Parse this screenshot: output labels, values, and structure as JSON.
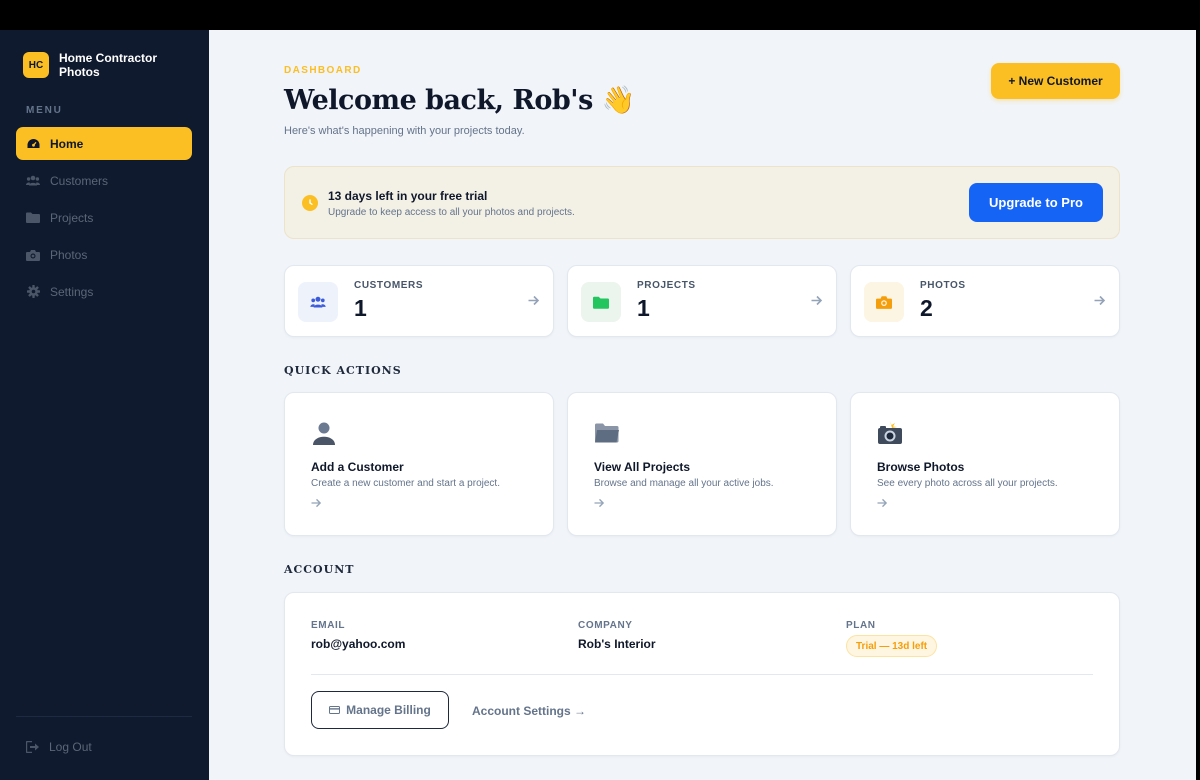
{
  "brand": {
    "initials": "HC",
    "name": "Home Contractor Photos"
  },
  "sidebar": {
    "menu_label": "MENU",
    "items": [
      {
        "label": "Home",
        "icon": "dashboard-icon",
        "active": true
      },
      {
        "label": "Customers",
        "icon": "users-icon",
        "active": false
      },
      {
        "label": "Projects",
        "icon": "folder-icon",
        "active": false
      },
      {
        "label": "Photos",
        "icon": "camera-icon",
        "active": false
      },
      {
        "label": "Settings",
        "icon": "gear-icon",
        "active": false
      }
    ],
    "logout_label": "Log Out"
  },
  "header": {
    "eyebrow": "DASHBOARD",
    "title": "Welcome back, Rob's 👋",
    "subtitle": "Here's what's happening with your projects today.",
    "new_customer_label": "+ New Customer"
  },
  "trial": {
    "title": "13 days left in your free trial",
    "subtitle": "Upgrade to keep access to all your photos and projects.",
    "upgrade_label": "Upgrade to Pro"
  },
  "stats": [
    {
      "label": "CUSTOMERS",
      "value": "1",
      "icon": "users-icon",
      "color": "#3b5bdb"
    },
    {
      "label": "PROJECTS",
      "value": "1",
      "icon": "folder-icon",
      "color": "#22c55e"
    },
    {
      "label": "PHOTOS",
      "value": "2",
      "icon": "camera-icon",
      "color": "#f59e0b"
    }
  ],
  "quick_actions": {
    "title": "QUICK ACTIONS",
    "items": [
      {
        "title": "Add a Customer",
        "desc": "Create a new customer and start a project.",
        "icon": "person-icon"
      },
      {
        "title": "View All Projects",
        "desc": "Browse and manage all your active jobs.",
        "icon": "folder-icon"
      },
      {
        "title": "Browse Photos",
        "desc": "See every photo across all your projects.",
        "icon": "camera-flash-icon"
      }
    ]
  },
  "account": {
    "title": "ACCOUNT",
    "email_label": "EMAIL",
    "email": "rob@yahoo.com",
    "company_label": "COMPANY",
    "company": "Rob's Interior",
    "plan_label": "PLAN",
    "plan": "Trial — 13d left",
    "billing_label": "Manage Billing",
    "settings_label": "Account Settings →"
  },
  "colors": {
    "accent": "#fbbf24",
    "primary": "#1664f6",
    "sidebar_bg": "#0f1a2e"
  }
}
